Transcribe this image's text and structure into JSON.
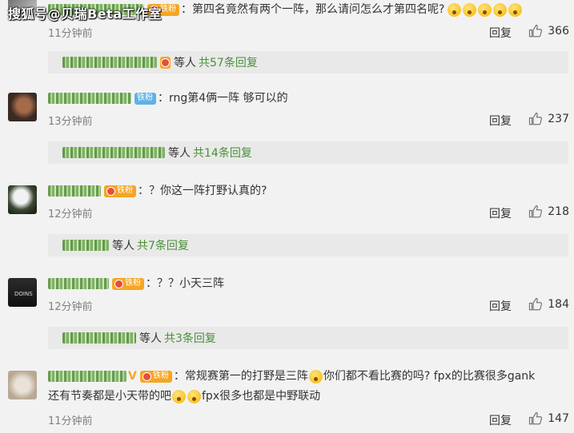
{
  "watermark": "搜狐号@贝瑞Beta工作室",
  "comments": [
    {
      "badge": "铁粉",
      "content": "：第四名竟然有两个一阵，那么请问怎么才第四名呢?",
      "time": "11分钟前",
      "reply_label": "回复",
      "likes": "366",
      "subreplies": {
        "others": "等人",
        "count": "共57条回复"
      }
    },
    {
      "badge": "铁粉",
      "content": "：rng第4俩一阵 够可以的",
      "time": "13分钟前",
      "reply_label": "回复",
      "likes": "237",
      "subreplies": {
        "others": "等人",
        "count": "共14条回复"
      }
    },
    {
      "badge": "铁粉",
      "content": "：？你这一阵打野认真的?",
      "time": "12分钟前",
      "reply_label": "回复",
      "likes": "218",
      "subreplies": {
        "others": "等人",
        "count": "共7条回复"
      }
    },
    {
      "badge": "铁粉",
      "content": "：？？小天三阵",
      "time": "12分钟前",
      "reply_label": "回复",
      "likes": "184",
      "subreplies": {
        "others": "等人",
        "count": "共3条回复"
      }
    },
    {
      "badge": "铁粉",
      "content_a": "：常规赛第一的打野是三阵",
      "content_b": "你们都不看比赛的吗? fpx的比赛很多gank",
      "content_c": "还有节奏都是小天带的吧",
      "content_d": "fpx很多也都是中野联动",
      "time": "11分钟前",
      "reply_label": "回复",
      "likes": "147"
    }
  ],
  "colors": {
    "accent_green": "#4a8f37",
    "badge_orange": "#f5a623",
    "badge_blue": "#5fb1e8"
  },
  "icons": {
    "like": "thumbs-up-icon",
    "emoji": "crying-emoji"
  }
}
